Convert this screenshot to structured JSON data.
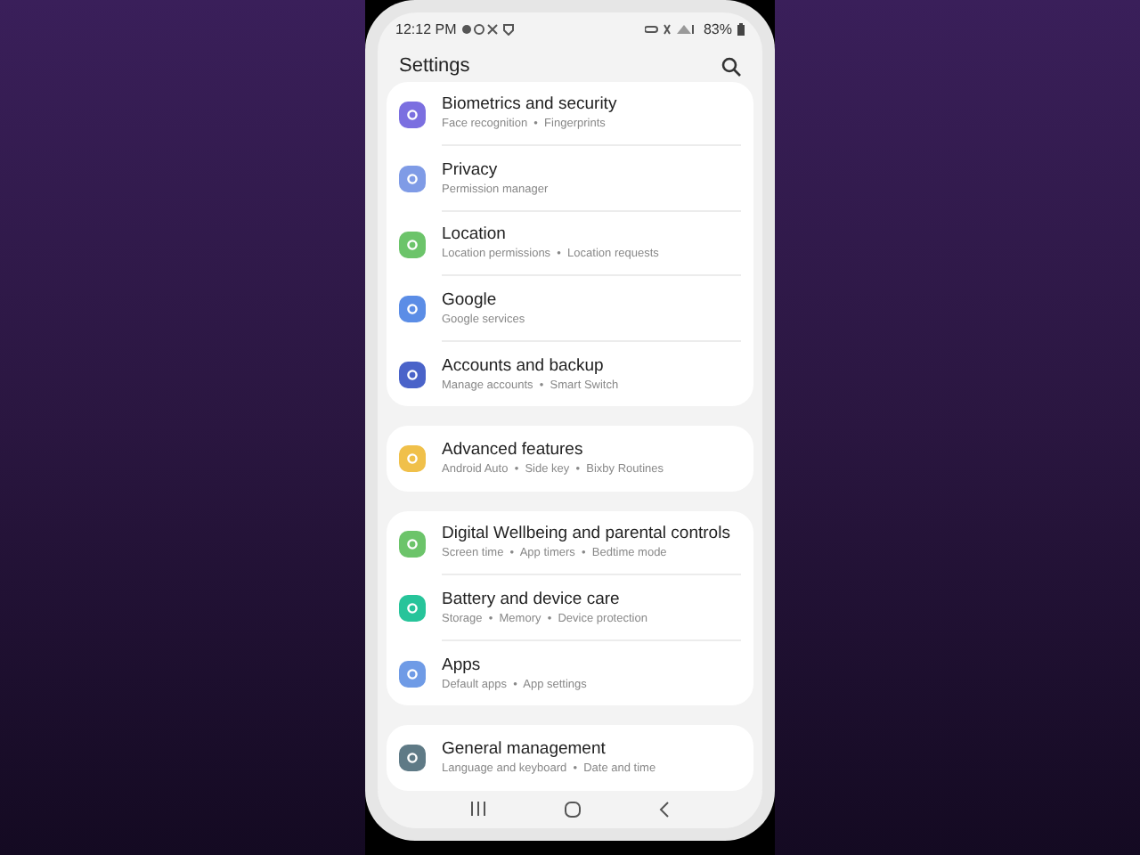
{
  "status_bar": {
    "time": "12:12 PM",
    "battery": "83%"
  },
  "header": {
    "title": "Settings"
  },
  "groups": [
    {
      "items": [
        {
          "title": "Biometrics and security",
          "subtitle": "Face recognition  •  Fingerprints",
          "color": "#7b6fe0"
        },
        {
          "title": "Privacy",
          "subtitle": "Permission manager",
          "color": "#7f9be6"
        },
        {
          "title": "Location",
          "subtitle": "Location permissions  •  Location requests",
          "color": "#6cc46a"
        },
        {
          "title": "Google",
          "subtitle": "Google services",
          "color": "#5b8de6"
        },
        {
          "title": "Accounts and backup",
          "subtitle": "Manage accounts  •  Smart Switch",
          "color": "#4a63c9"
        }
      ]
    },
    {
      "items": [
        {
          "title": "Advanced features",
          "subtitle": "Android Auto  •  Side key  •  Bixby Routines",
          "color": "#f0c04a"
        }
      ]
    },
    {
      "items": [
        {
          "title": "Digital Wellbeing and parental controls",
          "subtitle": "Screen time  •  App timers  •  Bedtime mode",
          "color": "#6cc46a"
        },
        {
          "title": "Battery and device care",
          "subtitle": "Storage  •  Memory  •  Device protection",
          "color": "#27c49a"
        },
        {
          "title": "Apps",
          "subtitle": "Default apps  •  App settings",
          "color": "#6f9be6"
        }
      ]
    },
    {
      "items": [
        {
          "title": "General management",
          "subtitle": "Language and keyboard  •  Date and time",
          "color": "#5f7a86"
        }
      ]
    }
  ]
}
